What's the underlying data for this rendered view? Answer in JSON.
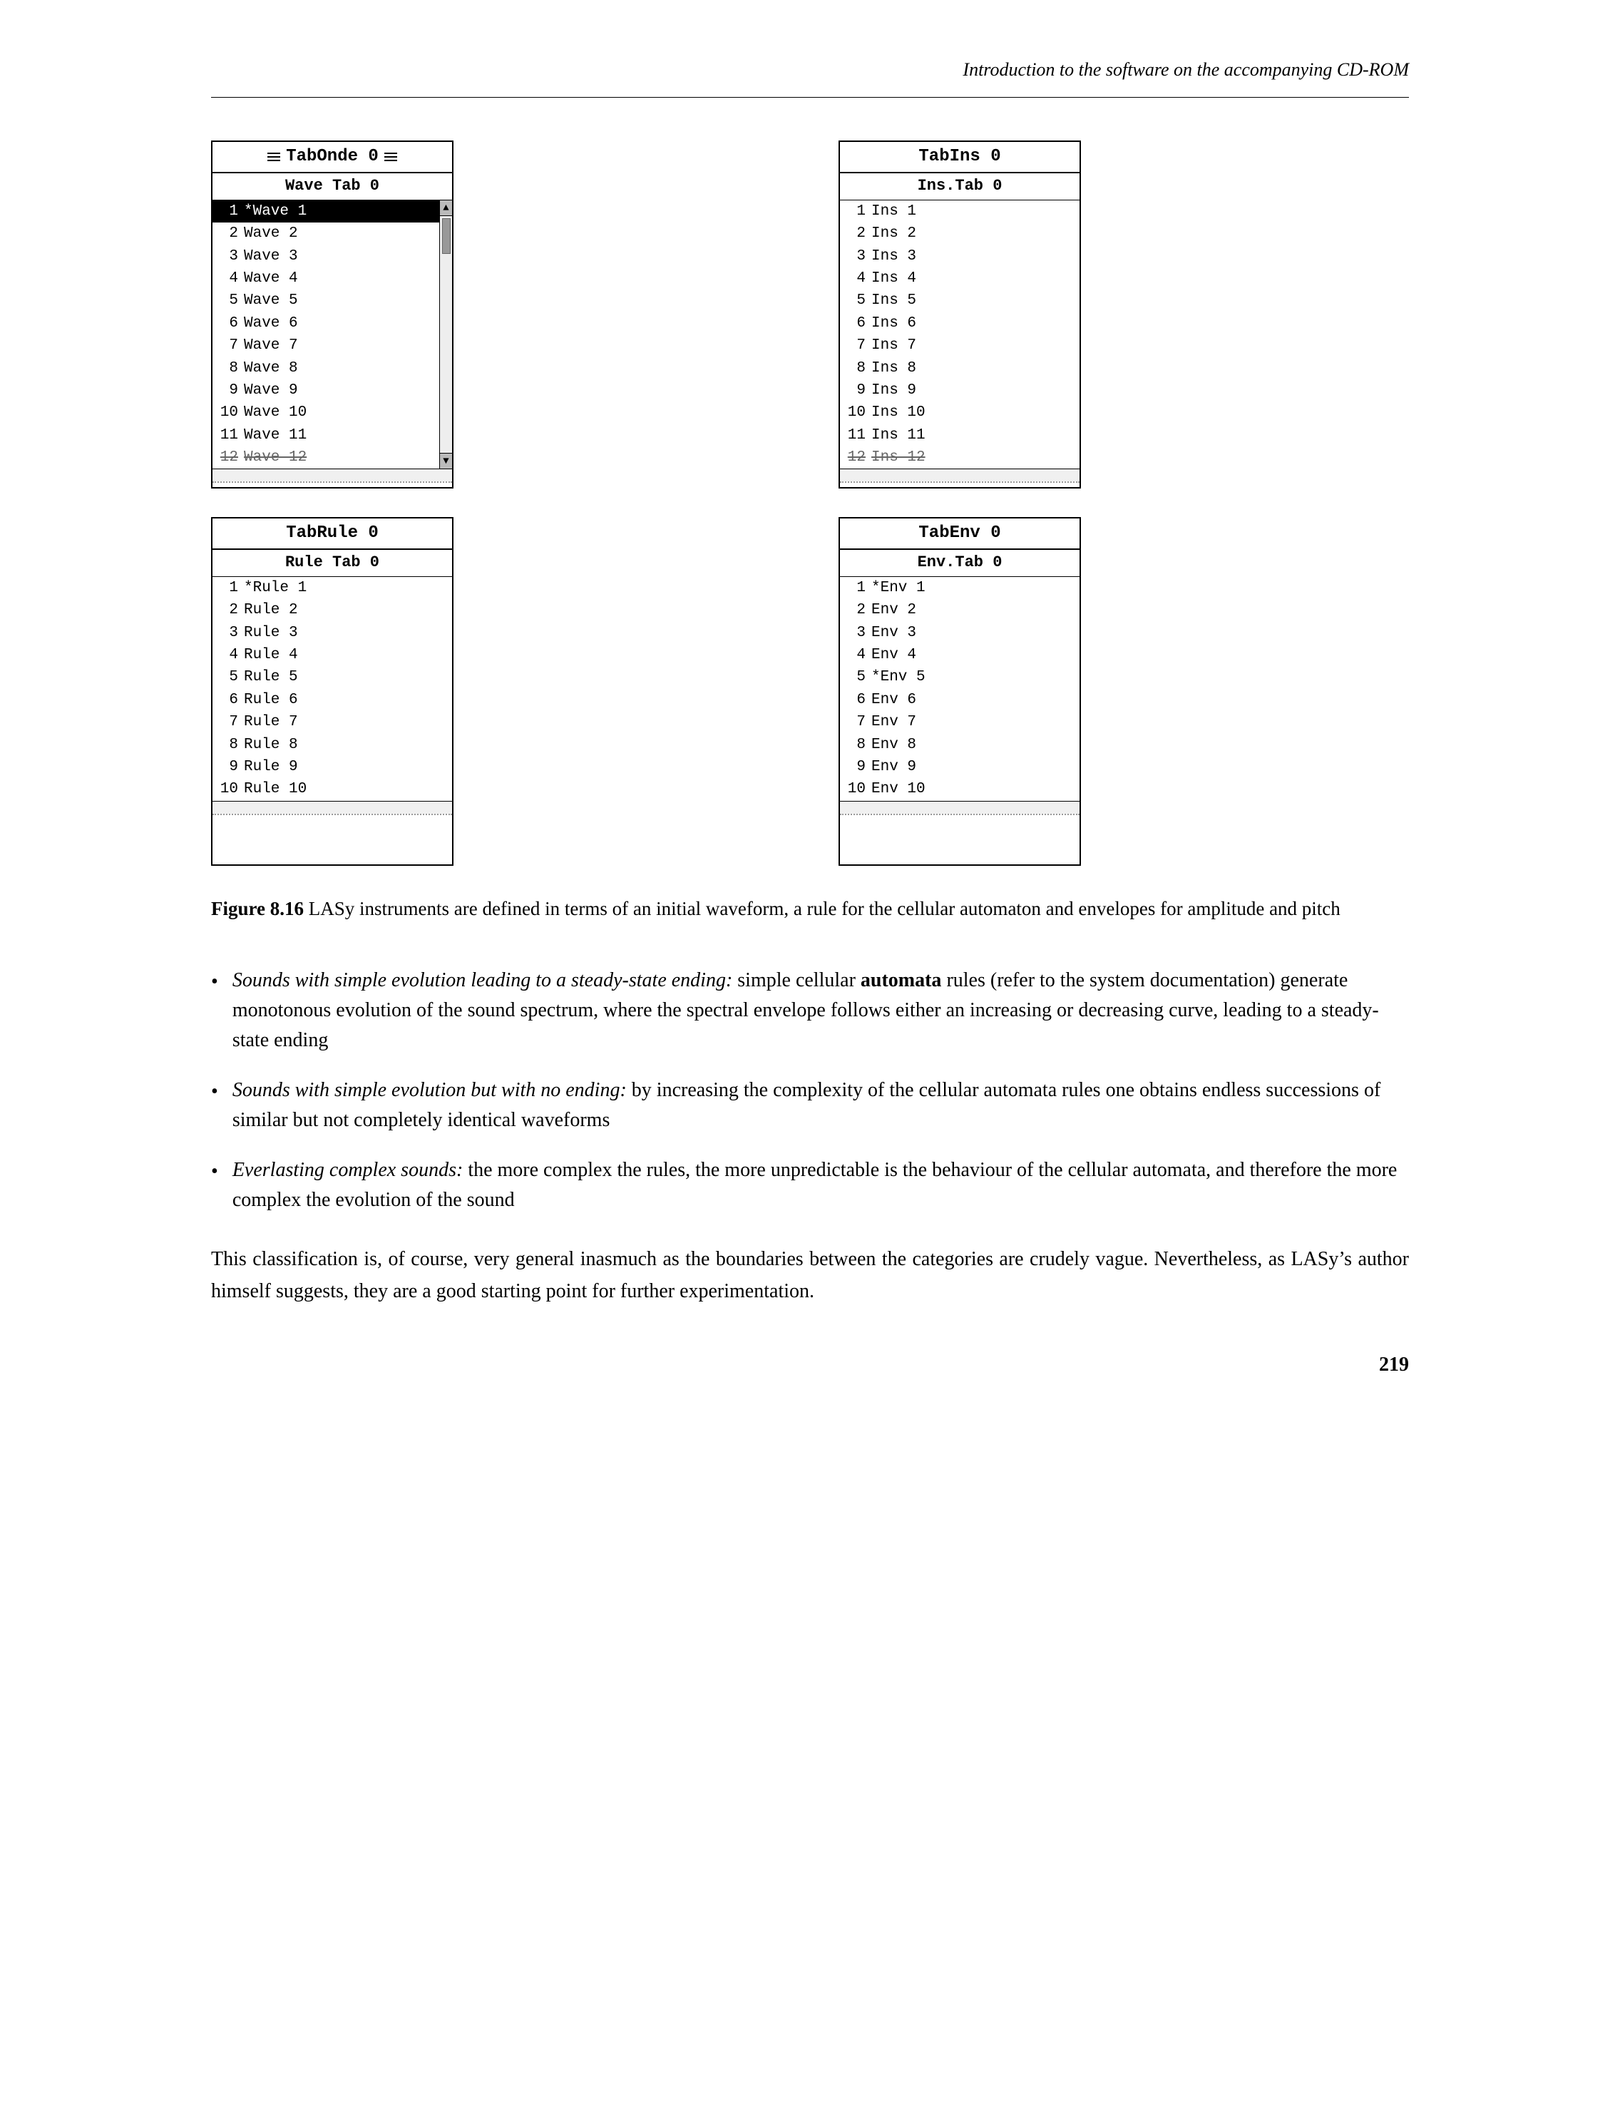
{
  "header": {
    "text": "Introduction to the software on the accompanying CD-ROM"
  },
  "panels": {
    "tabOnde": {
      "title": "TabOnde 0",
      "subtitle": "Wave Tab 0",
      "items": [
        {
          "num": "1",
          "text": "*Wave 1",
          "selected": true
        },
        {
          "num": "2",
          "text": "Wave 2"
        },
        {
          "num": "3",
          "text": "Wave 3"
        },
        {
          "num": "4",
          "text": "Wave 4"
        },
        {
          "num": "5",
          "text": "Wave 5"
        },
        {
          "num": "6",
          "text": "Wave 6"
        },
        {
          "num": "7",
          "text": "Wave 7"
        },
        {
          "num": "8",
          "text": "Wave 8"
        },
        {
          "num": "9",
          "text": "Wave 9"
        },
        {
          "num": "10",
          "text": "Wave 10"
        },
        {
          "num": "11",
          "text": "Wave 11"
        },
        {
          "num": "12",
          "text": "Wave 12",
          "strikethrough": true
        }
      ],
      "hasScrollbar": true
    },
    "tabIns": {
      "title": "TabIns 0",
      "subtitle": "Ins.Tab 0",
      "items": [
        {
          "num": "1",
          "text": "Ins 1"
        },
        {
          "num": "2",
          "text": "Ins 2"
        },
        {
          "num": "3",
          "text": "Ins 3"
        },
        {
          "num": "4",
          "text": "Ins 4"
        },
        {
          "num": "5",
          "text": "Ins 5"
        },
        {
          "num": "6",
          "text": "Ins 6"
        },
        {
          "num": "7",
          "text": "Ins 7"
        },
        {
          "num": "8",
          "text": "Ins 8"
        },
        {
          "num": "9",
          "text": "Ins 9"
        },
        {
          "num": "10",
          "text": "Ins 10"
        },
        {
          "num": "11",
          "text": "Ins 11"
        },
        {
          "num": "12",
          "text": "Ins 12",
          "strikethrough": true
        }
      ],
      "hasScrollbar": false
    },
    "tabRule": {
      "title": "TabRule 0",
      "subtitle": "Rule Tab 0",
      "items": [
        {
          "num": "1",
          "text": "*Rule 1"
        },
        {
          "num": "2",
          "text": "Rule 2"
        },
        {
          "num": "3",
          "text": "Rule 3"
        },
        {
          "num": "4",
          "text": "Rule 4"
        },
        {
          "num": "5",
          "text": "Rule 5"
        },
        {
          "num": "6",
          "text": "Rule 6"
        },
        {
          "num": "7",
          "text": "Rule 7"
        },
        {
          "num": "8",
          "text": "Rule 8"
        },
        {
          "num": "9",
          "text": "Rule 9"
        },
        {
          "num": "10",
          "text": "Rule 10"
        }
      ],
      "hasScrollbar": false
    },
    "tabEnv": {
      "title": "TabEnv 0",
      "subtitle": "Env.Tab 0",
      "items": [
        {
          "num": "1",
          "text": "*Env 1"
        },
        {
          "num": "2",
          "text": "Env 2"
        },
        {
          "num": "3",
          "text": "Env 3"
        },
        {
          "num": "4",
          "text": "Env 4"
        },
        {
          "num": "5",
          "text": "*Env 5"
        },
        {
          "num": "6",
          "text": "Env 6"
        },
        {
          "num": "7",
          "text": "Env 7"
        },
        {
          "num": "8",
          "text": "Env 8"
        },
        {
          "num": "9",
          "text": "Env 9"
        },
        {
          "num": "10",
          "text": "Env 10"
        }
      ],
      "hasScrollbar": false
    }
  },
  "figure_caption": {
    "label": "Figure 8.16",
    "text": " LASy instruments are defined in terms of an initial waveform, a rule for the cellular automaton and envelopes for amplitude and pitch"
  },
  "bullet_items": [
    {
      "italic_part": "Sounds with simple evolution leading to a steady-state ending:",
      "normal_part": " simple cellular automata rules (refer to the system documentation) generate monotonous evolution of the sound spectrum, where the spectral envelope follows either an increasing or decreasing curve, leading to a steady-state ending"
    },
    {
      "italic_part": "Sounds with simple evolution but with no ending:",
      "normal_part": " by increasing the complexity of the cellular automata rules one obtains endless successions of similar but not completely identical waveforms"
    },
    {
      "italic_part": "Everlasting complex sounds:",
      "normal_part": " the more complex the rules, the more unpredictable is the behaviour of the cellular automata, and therefore the more complex the evolution of the sound"
    }
  ],
  "body_paragraph": "This classification is, of course, very general inasmuch as the boundaries between the categories are crudely vague. Nevertheless, as LASy’s author himself suggests, they are a good starting point for further experimentation.",
  "page_number": "219"
}
